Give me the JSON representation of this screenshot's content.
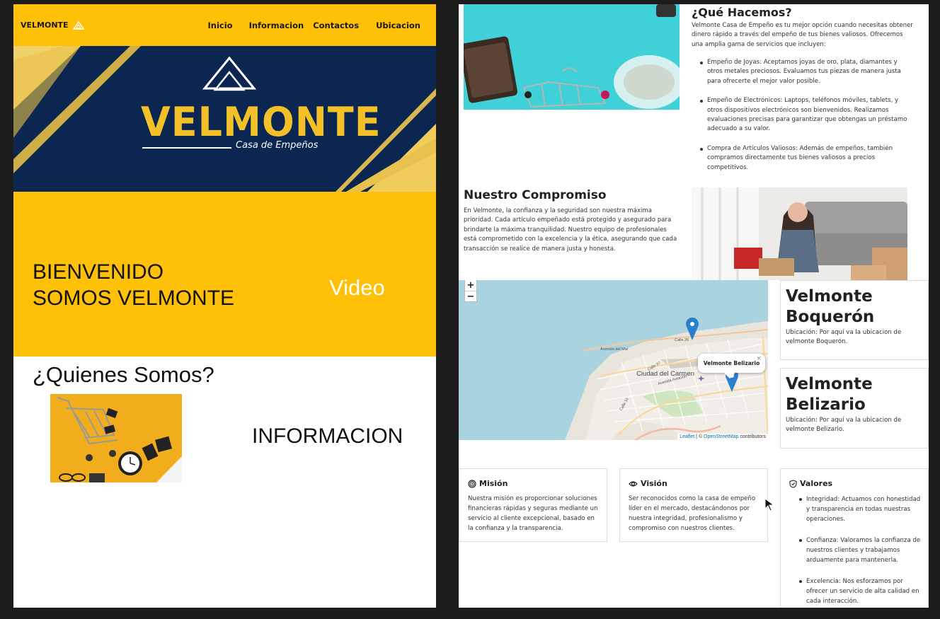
{
  "left_page": {
    "nav": {
      "brand": "VELMONTE",
      "links": [
        "Inicio",
        "Informacion",
        "Contactos",
        "Ubicacion"
      ]
    },
    "hero": {
      "logo_text": "VELMONTE",
      "logo_subtitle": "Casa de Empeños",
      "colors": {
        "navy": "#0b2651",
        "gold": "#f4c028"
      }
    },
    "welcome": {
      "line1": "BIENVENIDO",
      "line2": "SOMOS VELMONTE",
      "video_label": "Video"
    },
    "about": {
      "title": "¿Quienes Somos?",
      "info_label": "INFORMACION"
    },
    "colors": {
      "accent": "#ffc107"
    }
  },
  "right_page": {
    "que_hacemos": {
      "title": "¿Qué Hacemos?",
      "description": "Velmonte Casa de Empeño es tu mejor opción cuando necesitas obtener dinero rápido a través del empeño de tus bienes valiosos. Ofrecemos una amplia gama de servicios que incluyen:",
      "items": [
        "Empeño de Joyas: Aceptamos joyas de oro, plata, diamantes y otros metales preciosos. Evaluamos tus piezas de manera justa para ofrecerte el mejor valor posible.",
        "Empeño de Electrónicos: Laptops, teléfonos móviles, tablets, y otros dispositivos electrónicos son bienvenidos. Realizamos evaluaciones precisas para garantizar que obtengas un préstamo adecuado a su valor.",
        "Compra de Artículos Valiosos: Además de empeños, también compramos directamente tus bienes valiosos a precios competitivos."
      ]
    },
    "compromiso": {
      "title": "Nuestro Compromiso",
      "text": "En Velmonte, la confianza y la seguridad son nuestra máxima prioridad. Cada artículo empeñado está protegido y asegurado para brindarte la máxima tranquilidad. Nuestro equipo de profesionales está comprometido con la excelencia y la ética, asegurando que cada transacción se realice de manera justa y honesta."
    },
    "map": {
      "zoom_in": "+",
      "zoom_out": "−",
      "popup": "Velmonte Belizario",
      "popup_close": "×",
      "city_label": "Ciudad del Carmen",
      "street_labels": [
        "Avenida del Mar",
        "Calle 37",
        "Calle 31",
        "Avenida Aviación",
        "Calle 26"
      ],
      "attribution_leaflet": "Leaflet",
      "attribution_sep": " | © ",
      "attribution_osm": "OpenStreetMap",
      "attribution_tail": " contributors"
    },
    "locations": [
      {
        "name": "Velmonte Boquerón",
        "address": "Ubicación: Por aquí va la ubicacion de velmonte Boquerón."
      },
      {
        "name": "Velmonte Belizario",
        "address": "Ubicación: Por aquí va la ubicacion de velmonte Belizario."
      }
    ],
    "mision": {
      "title": "Misión",
      "text": "Nuestra misión es proporcionar soluciones financieras rápidas y seguras mediante un servicio al cliente excepcional, basado en la confianza y la transparencia."
    },
    "vision": {
      "title": "Visión",
      "text": "Ser reconocidos como la casa de empeño líder en el mercado, destacándonos por nuestra integridad, profesionalismo y compromiso con nuestros clientes."
    },
    "valores": {
      "title": "Valores",
      "items": [
        "Integridad: Actuamos con honestidad y transparencia en todas nuestras operaciones.",
        "Confianza: Valoramos la confianza de nuestros clientes y trabajamos arduamente para mantenerla.",
        "Excelencia: Nos esforzamos por ofrecer un servicio de alta calidad en cada interacción."
      ]
    },
    "colors": {
      "map_water": "#a9d3df",
      "marker": "#2a81cb"
    }
  }
}
